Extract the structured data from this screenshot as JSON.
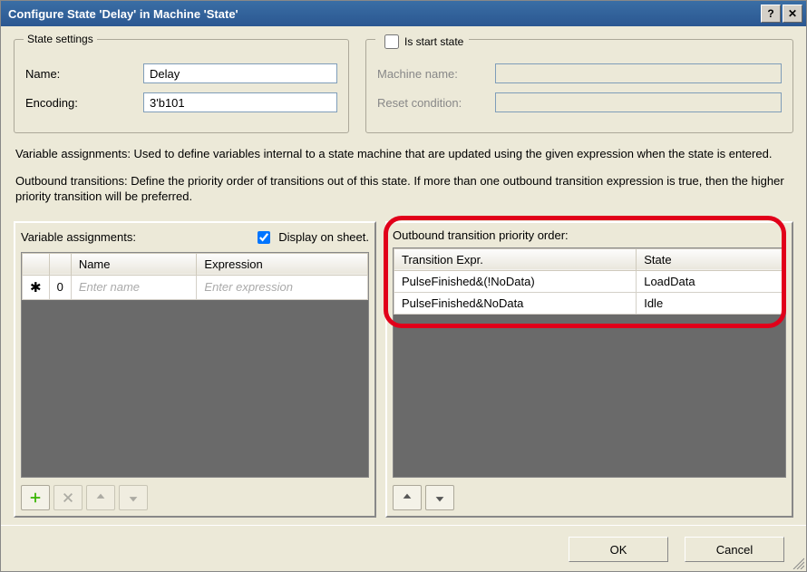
{
  "window": {
    "title": "Configure State 'Delay' in Machine 'State'"
  },
  "state_settings": {
    "legend": "State settings",
    "name_label": "Name:",
    "name_value": "Delay",
    "encoding_label": "Encoding:",
    "encoding_value": "3'b101"
  },
  "start_state": {
    "checkbox_label": "Is start state",
    "checked": false,
    "machine_name_label": "Machine name:",
    "machine_name_value": "",
    "reset_condition_label": "Reset condition:",
    "reset_condition_value": ""
  },
  "help": {
    "variable_assignments": "Variable assignments: Used to define variables internal to a state machine that are updated using the given expression when the state is entered.",
    "outbound_transitions": "Outbound transitions: Define the priority order of transitions out of this state. If more than one outbound transition expression is true, then the higher priority transition will be preferred."
  },
  "var_panel": {
    "title": "Variable assignments:",
    "display_label": "Display on sheet.",
    "display_checked": true,
    "columns": {
      "name": "Name",
      "expression": "Expression"
    },
    "new_row": {
      "index": "0",
      "name_placeholder": "Enter name",
      "expr_placeholder": "Enter expression"
    }
  },
  "trans_panel": {
    "title": "Outbound transition priority order:",
    "columns": {
      "expr": "Transition Expr.",
      "state": "State"
    },
    "rows": [
      {
        "expr": "PulseFinished&(!NoData)",
        "state": "LoadData"
      },
      {
        "expr": "PulseFinished&NoData",
        "state": "Idle"
      }
    ]
  },
  "buttons": {
    "ok": "OK",
    "cancel": "Cancel"
  }
}
